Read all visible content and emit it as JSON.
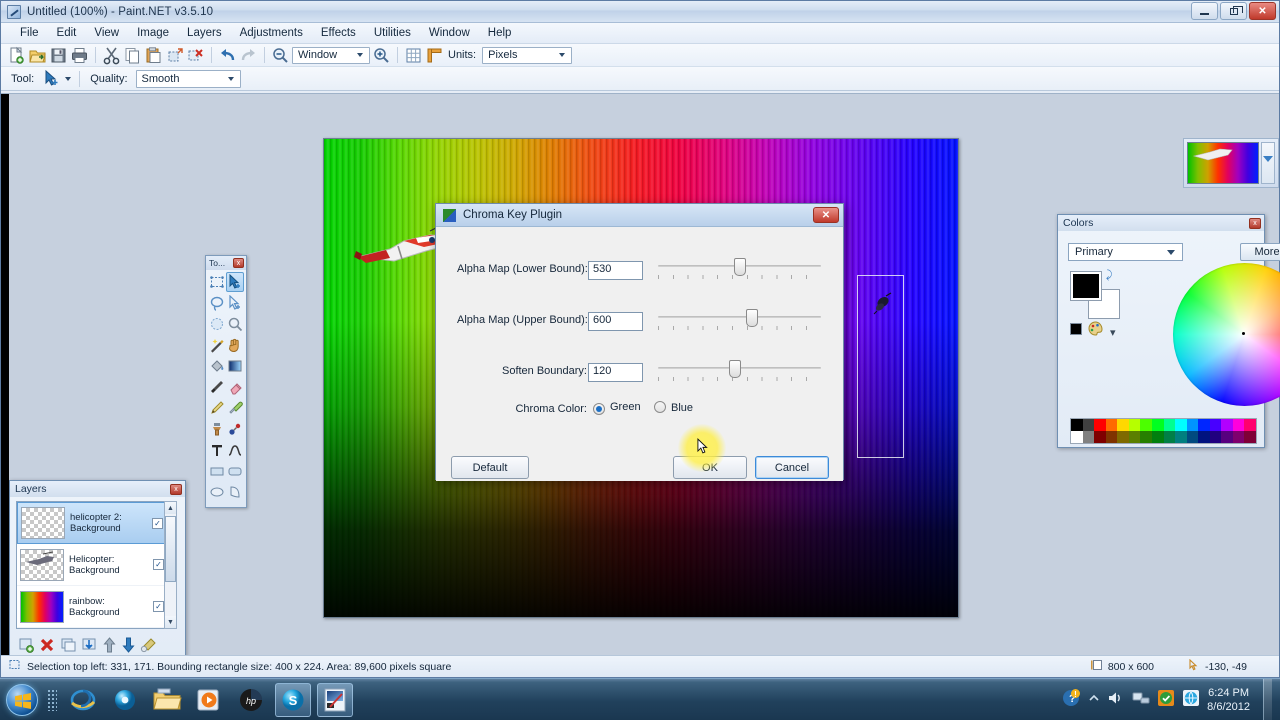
{
  "window": {
    "title": "Untitled (100%) - Paint.NET v3.5.10",
    "app_icon": "paintnet-icon",
    "minimize_label": "Minimize",
    "restore_label": "Restore",
    "close_label": "Close"
  },
  "menu": {
    "items": [
      {
        "label": "File"
      },
      {
        "label": "Edit"
      },
      {
        "label": "View"
      },
      {
        "label": "Image"
      },
      {
        "label": "Layers"
      },
      {
        "label": "Adjustments"
      },
      {
        "label": "Effects"
      },
      {
        "label": "Utilities"
      },
      {
        "label": "Window"
      },
      {
        "label": "Help"
      }
    ]
  },
  "toolbar": {
    "icons": [
      {
        "name": "new-icon"
      },
      {
        "name": "open-icon"
      },
      {
        "name": "save-icon"
      },
      {
        "name": "print-icon"
      },
      {
        "name": "cut-icon"
      },
      {
        "name": "copy-icon"
      },
      {
        "name": "paste-icon"
      },
      {
        "name": "crop-to-selection-icon"
      },
      {
        "name": "deselect-icon"
      },
      {
        "name": "undo-icon"
      },
      {
        "name": "redo-icon"
      }
    ],
    "zoom_out_icon": "zoom-out-icon",
    "zoom_in_icon": "zoom-in-icon",
    "zoom_value": "Window",
    "grid_icon": "grid-icon",
    "rulers_icon": "rulers-icon",
    "units_label": "Units:",
    "units_value": "Pixels"
  },
  "tool_options": {
    "tool_label": "Tool:",
    "tool_icon": "move-selection-icon",
    "quality_label": "Quality:",
    "quality_value": "Smooth"
  },
  "tools_palette": {
    "title": "To...",
    "close_label": "x",
    "tools": [
      {
        "name": "rectangle-select-icon",
        "selected": false
      },
      {
        "name": "move-selected-icon",
        "selected": true
      },
      {
        "name": "lasso-select-icon",
        "selected": false
      },
      {
        "name": "move-selection-icon",
        "selected": false
      },
      {
        "name": "ellipse-select-icon",
        "selected": false
      },
      {
        "name": "zoom-icon",
        "selected": false
      },
      {
        "name": "magic-wand-icon",
        "selected": false
      },
      {
        "name": "pan-hand-icon",
        "selected": false
      },
      {
        "name": "paint-bucket-icon",
        "selected": false
      },
      {
        "name": "gradient-icon",
        "selected": false
      },
      {
        "name": "paintbrush-icon",
        "selected": false
      },
      {
        "name": "eraser-icon",
        "selected": false
      },
      {
        "name": "pencil-icon",
        "selected": false
      },
      {
        "name": "color-picker-icon",
        "selected": false
      },
      {
        "name": "clone-stamp-icon",
        "selected": false
      },
      {
        "name": "recolor-icon",
        "selected": false
      },
      {
        "name": "text-icon",
        "selected": false
      },
      {
        "name": "line-curve-icon",
        "selected": false
      },
      {
        "name": "rectangle-shape-icon",
        "selected": false
      },
      {
        "name": "rounded-rectangle-icon",
        "selected": false
      },
      {
        "name": "ellipse-shape-icon",
        "selected": false
      },
      {
        "name": "freeform-shape-icon",
        "selected": false
      }
    ]
  },
  "layers_window": {
    "title": "Layers",
    "close_label": "x",
    "layers": [
      {
        "name_line1": "helicopter 2:",
        "name_line2": "Background",
        "visible": "✓",
        "thumb": "transparent-checker",
        "selected": true
      },
      {
        "name_line1": "Helicopter:",
        "name_line2": "Background",
        "visible": "✓",
        "thumb": "transparent-checker-helicopter",
        "selected": false
      },
      {
        "name_line1": "rainbow:",
        "name_line2": "Background",
        "visible": "✓",
        "thumb": "rainbow",
        "selected": false
      }
    ],
    "buttons": [
      {
        "name": "add-layer-icon"
      },
      {
        "name": "delete-layer-icon"
      },
      {
        "name": "duplicate-layer-icon"
      },
      {
        "name": "merge-layer-down-icon"
      },
      {
        "name": "move-layer-up-icon"
      },
      {
        "name": "move-layer-down-icon"
      },
      {
        "name": "layer-properties-icon"
      }
    ],
    "scroll_up": "▲",
    "scroll_down": "▼"
  },
  "colors_window": {
    "title": "Colors",
    "close_label": "x",
    "mode_value": "Primary",
    "more_label": "More >>",
    "primary_color": "#000000",
    "secondary_color": "#ffffff",
    "swap_icon": "swap-colors-icon",
    "add-color_icon": "add-color-icon",
    "palette_icon": "palette-icon",
    "palette_colors_row1": [
      "#000000",
      "#404040",
      "#ff0000",
      "#ff6a00",
      "#ffd800",
      "#b6ff00",
      "#4cff00",
      "#00ff21",
      "#00ff90",
      "#00ffff",
      "#0094ff",
      "#0026ff",
      "#4800ff",
      "#b200ff",
      "#ff00dc",
      "#ff006e"
    ],
    "palette_colors_row2": [
      "#ffffff",
      "#808080",
      "#7f0000",
      "#7f3300",
      "#7f6a00",
      "#5b7f00",
      "#267f00",
      "#007f0e",
      "#007f46",
      "#007f7f",
      "#004a7f",
      "#00137f",
      "#21007f",
      "#57007f",
      "#7f006e",
      "#7f0037"
    ]
  },
  "canvas": {
    "image_description": "rainbow-gradient-image",
    "selection_visible": true,
    "helicopter_layer_icon": "helicopter-sprite",
    "helicopter2_layer_icon": "helicopter-sprite-small"
  },
  "thumbnail_strip": {
    "thumbnail_name": "image-thumbnail-untitled"
  },
  "statusbar": {
    "selection_icon": "selection-icon",
    "selection_text": "Selection top left: 331, 171. Bounding rectangle size: 400 x 224. Area: 89,600 pixels square",
    "size_icon": "image-size-icon",
    "size_text": "800 x 600",
    "cursor_icon": "cursor-position-icon",
    "cursor_text": "-130, -49"
  },
  "dialog": {
    "title": "Chroma Key Plugin",
    "icon": "chroma-key-icon",
    "close_label": "✕",
    "fields": [
      {
        "label": "Alpha Map (Lower Bound):",
        "value": "530",
        "slider_percent": 50
      },
      {
        "label": "Alpha Map (Upper Bound):",
        "value": "600",
        "slider_percent": 58
      },
      {
        "label": "Soften Boundary:",
        "value": "120",
        "slider_percent": 47
      }
    ],
    "chroma_color_label": "Chroma Color:",
    "chroma_options": [
      {
        "label": "Green",
        "selected": true
      },
      {
        "label": "Blue",
        "selected": false
      }
    ],
    "default_button": "Default",
    "ok_button": "OK",
    "cancel_button": "Cancel"
  },
  "taskbar": {
    "start_icon": "windows-start-orb",
    "items": [
      {
        "name": "internet-explorer-icon",
        "active": false
      },
      {
        "name": "blue-orb-icon",
        "active": false
      },
      {
        "name": "windows-explorer-icon",
        "active": false
      },
      {
        "name": "windows-media-player-icon",
        "active": false
      },
      {
        "name": "hp-support-icon",
        "active": false
      },
      {
        "name": "skype-icon",
        "active": true
      },
      {
        "name": "paint-net-icon",
        "active": true
      }
    ],
    "tray": [
      {
        "name": "action-center-icon"
      },
      {
        "name": "show-hidden-icons-icon"
      },
      {
        "name": "volume-icon"
      },
      {
        "name": "network-icon"
      },
      {
        "name": "security-icon"
      },
      {
        "name": "browser-icon"
      }
    ],
    "time": "6:24 PM",
    "date": "8/6/2012"
  }
}
